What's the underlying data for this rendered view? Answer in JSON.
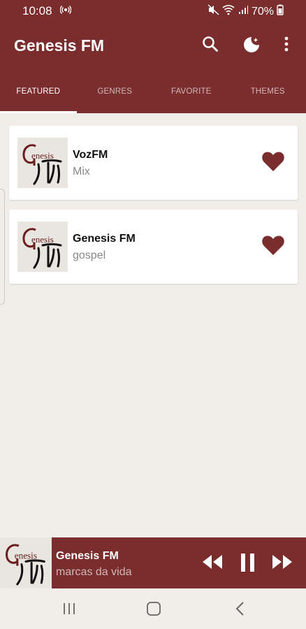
{
  "status": {
    "time": "10:08",
    "battery": "70%"
  },
  "app": {
    "title": "Genesis FM"
  },
  "tabs": [
    {
      "label": "FEATURED",
      "active": true
    },
    {
      "label": "GENRES",
      "active": false
    },
    {
      "label": "FAVORITE",
      "active": false
    },
    {
      "label": "THEMES",
      "active": false
    }
  ],
  "stations": [
    {
      "name": "VozFM",
      "genre": "Mix",
      "favorite": true
    },
    {
      "name": "Genesis FM",
      "genre": "gospel",
      "favorite": true
    }
  ],
  "player": {
    "station": "Genesis FM",
    "track": "marcas da vida"
  },
  "colors": {
    "primary": "#7b2c2c",
    "background": "#f1eeea",
    "card": "#ffffff"
  }
}
